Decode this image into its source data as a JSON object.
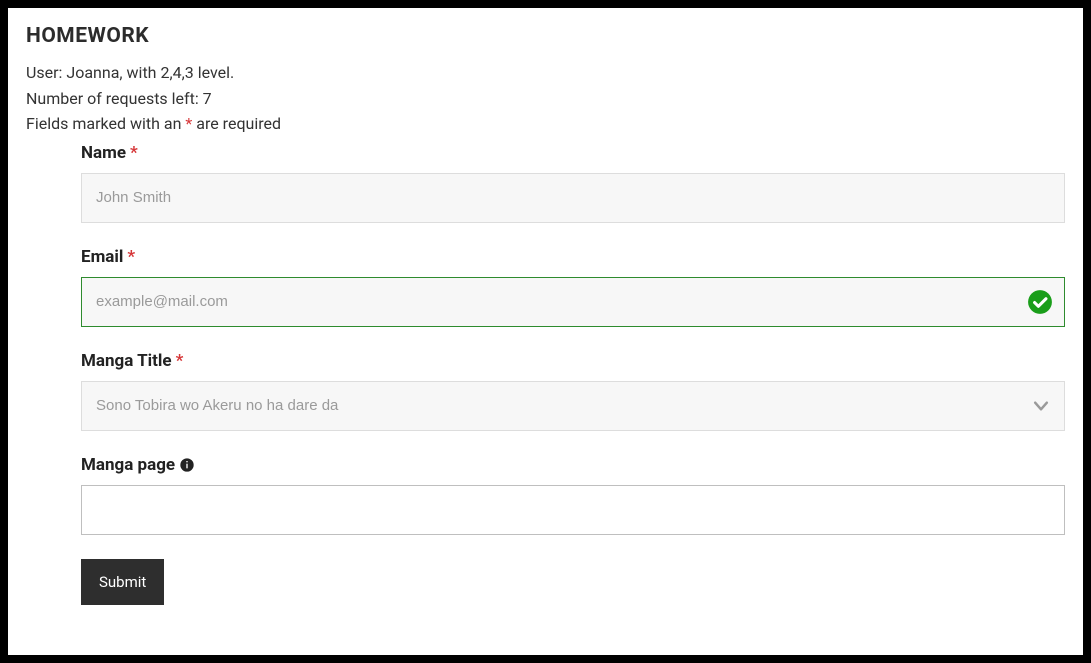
{
  "header": {
    "title": "HOMEWORK",
    "user_line": "User: Joanna, with 2,4,3 level.",
    "requests_line": "Number of requests left: 7",
    "required_prefix": "Fields marked with an ",
    "required_star": "*",
    "required_suffix": " are required"
  },
  "form": {
    "name": {
      "label": "Name",
      "placeholder": "John Smith",
      "value": ""
    },
    "email": {
      "label": "Email",
      "placeholder": "example@mail.com",
      "value": "",
      "valid": true
    },
    "manga_title": {
      "label": "Manga Title",
      "selected": "Sono Tobira wo Akeru no ha dare da"
    },
    "manga_page": {
      "label": "Manga page",
      "value": ""
    },
    "submit_label": "Submit"
  },
  "required_marker": "*"
}
